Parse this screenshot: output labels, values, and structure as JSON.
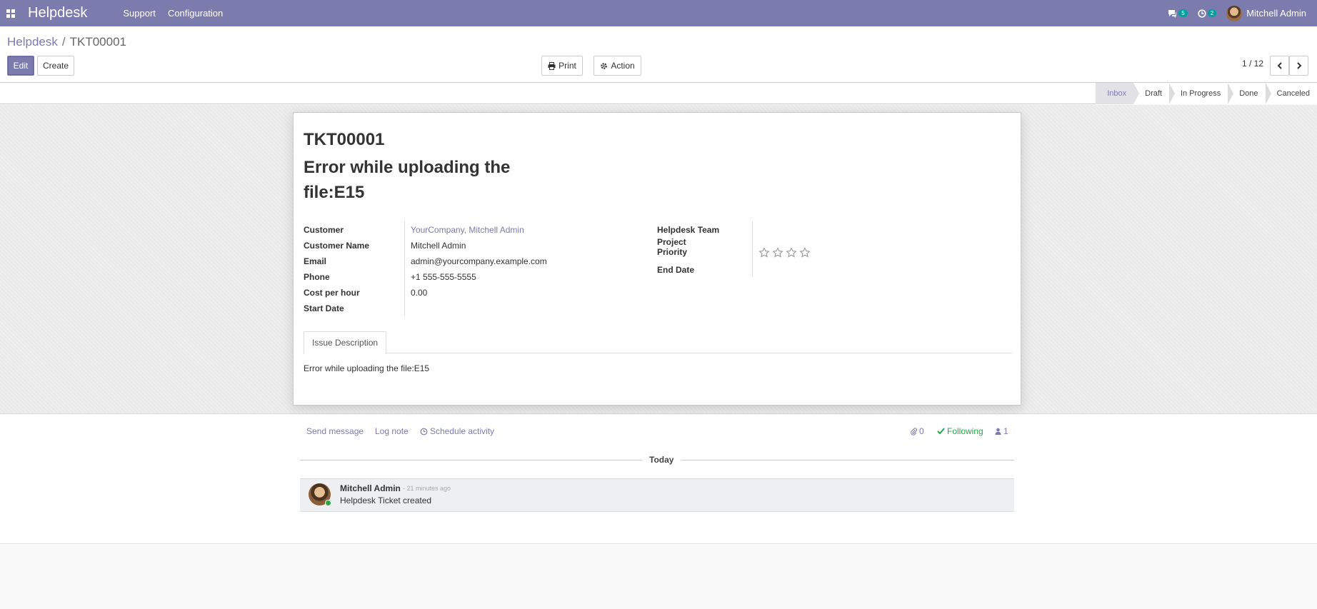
{
  "navbar": {
    "brand": "Helpdesk",
    "menu": [
      "Support",
      "Configuration"
    ],
    "messages_count": "5",
    "activities_count": "2",
    "user_name": "Mitchell Admin"
  },
  "breadcrumb": {
    "parent": "Helpdesk",
    "separator": "/",
    "current": "TKT00001"
  },
  "buttons": {
    "edit": "Edit",
    "create": "Create",
    "print": "Print",
    "action": "Action"
  },
  "pager": {
    "value": "1 / 12"
  },
  "stages": [
    "Inbox",
    "Draft",
    "In Progress",
    "Done",
    "Canceled"
  ],
  "active_stage": "Inbox",
  "ticket": {
    "number": "TKT00001",
    "title": "Error while uploading the file:E15"
  },
  "left_fields": [
    {
      "label": "Customer",
      "value": "YourCompany, Mitchell Admin",
      "link": true
    },
    {
      "label": "Customer Name",
      "value": "Mitchell Admin",
      "link": false
    },
    {
      "label": "Email",
      "value": "admin@yourcompany.example.com",
      "link": false
    },
    {
      "label": "Phone",
      "value": "+1 555-555-5555",
      "link": false
    },
    {
      "label": "Cost per hour",
      "value": "0.00",
      "link": false
    },
    {
      "label": "Start Date",
      "value": "",
      "link": false
    }
  ],
  "right_fields": {
    "helpdesk_team_label": "Helpdesk Team",
    "helpdesk_team_value": "",
    "project_label": "Project",
    "project_value": "",
    "priority_label": "Priority",
    "priority_stars_max": 4,
    "priority_stars_filled": 0,
    "end_date_label": "End Date",
    "end_date_value": ""
  },
  "tabs": [
    {
      "label": "Issue Description"
    }
  ],
  "issue_description": "Error while uploading the file:E15",
  "chatter": {
    "send_message": "Send message",
    "log_note": "Log note",
    "schedule_activity": "Schedule activity",
    "attachments_count": "0",
    "following": "Following",
    "followers_count": "1",
    "date_label": "Today",
    "message": {
      "author": "Mitchell Admin",
      "time": "- 21 minutes ago",
      "body": "Helpdesk Ticket created"
    }
  },
  "colors": {
    "brand": "#7c7bad",
    "badge": "#00a09d",
    "following": "#28a745"
  }
}
